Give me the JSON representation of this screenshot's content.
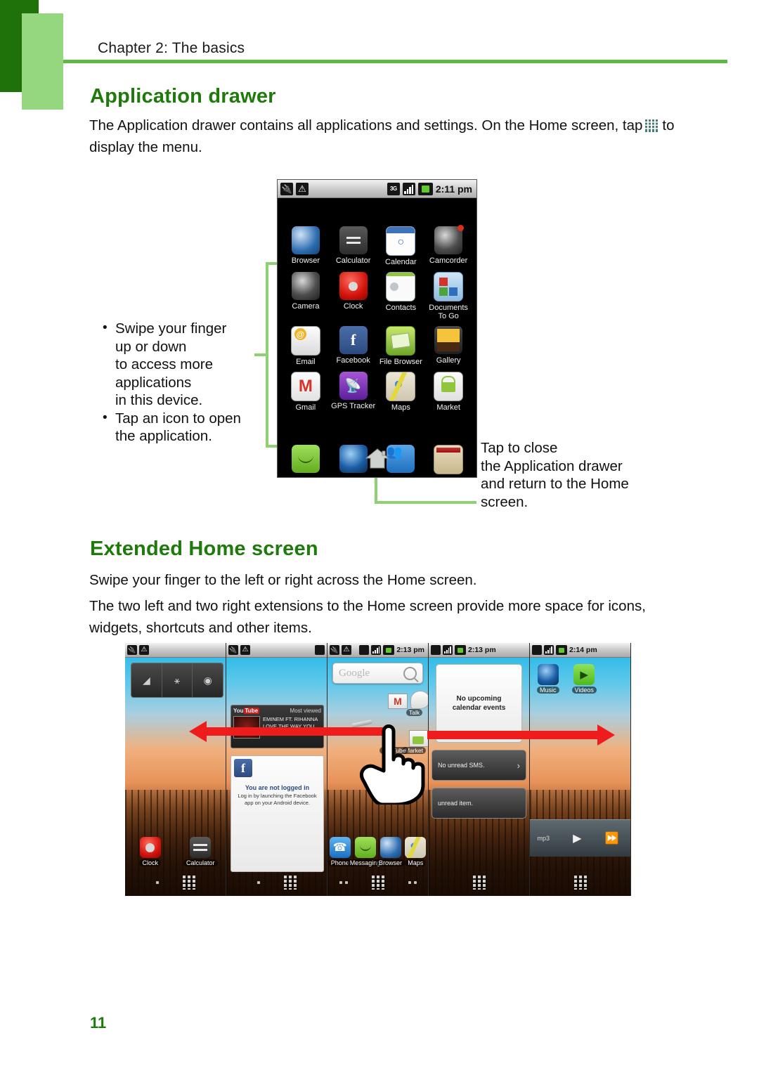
{
  "header": {
    "chapter": "Chapter 2: The basics"
  },
  "sections": {
    "app_drawer": {
      "heading": "Application drawer",
      "intro_before": "The Application drawer contains all applications and settings. On the Home screen, tap",
      "intro_after": "to display the menu.",
      "drawer_icon": "app-drawer-grid-icon"
    },
    "extended_home": {
      "heading": "Extended Home screen",
      "paragraph1": "Swipe your finger to the left or right across the Home screen.",
      "paragraph2": "The two left and two right extensions to the Home screen provide more space for icons, widgets, shortcuts and other items."
    }
  },
  "callouts": {
    "left": [
      {
        "line1": "Swipe your finger",
        "line2": "up or down",
        "line3": "to access more",
        "line4": "applications",
        "line5": "in this device."
      },
      {
        "line1": "Tap an icon to open",
        "line2": "the application."
      }
    ],
    "right": {
      "line1": "Tap to close",
      "line2": "the Application drawer",
      "line3": "and return to the Home",
      "line4": "screen."
    }
  },
  "phone_drawer": {
    "status_bar": {
      "usb_icon": "usb-icon",
      "warning_icon": "warning-triangle-icon",
      "network_label": "3G",
      "signal_icon": "signal-bars-icon",
      "battery_icon": "battery-icon",
      "time": "2:11 pm"
    },
    "apps": [
      {
        "label": "Browser",
        "icon": "browser-globe-icon"
      },
      {
        "label": "Calculator",
        "icon": "calculator-icon"
      },
      {
        "label": "Calendar",
        "icon": "calendar-icon"
      },
      {
        "label": "Camcorder",
        "icon": "camcorder-icon"
      },
      {
        "label": "Camera",
        "icon": "camera-icon"
      },
      {
        "label": "Clock",
        "icon": "clock-icon"
      },
      {
        "label": "Contacts",
        "icon": "contacts-icon"
      },
      {
        "label": "Documents To Go",
        "icon": "documents-to-go-icon"
      },
      {
        "label": "Email",
        "icon": "email-icon"
      },
      {
        "label": "Facebook",
        "icon": "facebook-icon"
      },
      {
        "label": "File Browser",
        "icon": "file-browser-icon"
      },
      {
        "label": "Gallery",
        "icon": "gallery-icon"
      },
      {
        "label": "Gmail",
        "icon": "gmail-icon"
      },
      {
        "label": "GPS Tracker",
        "icon": "gps-tracker-icon"
      },
      {
        "label": "Maps",
        "icon": "maps-icon"
      },
      {
        "label": "Market",
        "icon": "market-icon"
      }
    ],
    "home_button": "home-icon"
  },
  "home_panels": [
    {
      "name": "panel-left-2",
      "status_bar": {
        "time": ""
      },
      "toggles": [
        "wifi-icon",
        "bluetooth-icon",
        "gps-icon"
      ],
      "dock": [
        {
          "label": "Clock",
          "icon": "clock-icon"
        },
        {
          "label": "Calculator",
          "icon": "calculator-icon"
        }
      ]
    },
    {
      "name": "panel-left-1",
      "status_bar": {
        "time": ""
      },
      "youtube_widget": {
        "logo": "YouTube",
        "title": "Most viewed",
        "item_line1": "EMINEM FT. RIHANNA",
        "item_line2": "LOVE THE WAY YOU LIE"
      },
      "facebook_widget": {
        "title": "You are not logged in",
        "body": "Log in by launching the Facebook app on your Android device."
      }
    },
    {
      "name": "panel-center-home",
      "status_bar": {
        "time": "2:13 pm"
      },
      "search": {
        "placeholder": "Google",
        "icon": "search-magnifier-icon"
      },
      "shortcuts": [
        {
          "label": "Talk",
          "icon": "talk-icon"
        },
        {
          "label": "Market",
          "icon": "market-icon"
        },
        {
          "label": "YouTube",
          "icon": "youtube-icon"
        }
      ],
      "dock": [
        {
          "label": "Phone",
          "icon": "phone-icon"
        },
        {
          "label": "Messaging",
          "icon": "messaging-icon"
        },
        {
          "label": "Browser",
          "icon": "browser-globe-icon"
        },
        {
          "label": "Maps",
          "icon": "maps-icon"
        }
      ]
    },
    {
      "name": "panel-right-1",
      "status_bar": {
        "time": "2:13 pm"
      },
      "calendar_widget": {
        "line1": "No upcoming",
        "line2": "calendar events"
      },
      "sms_widget": {
        "text": "No unread SMS.",
        "chevron": "chevron-right-icon"
      },
      "news_widget": {
        "text": "unread item."
      }
    },
    {
      "name": "panel-right-2",
      "status_bar": {
        "time": "2:14 pm"
      },
      "icons": [
        {
          "label": "Music",
          "icon": "music-icon"
        },
        {
          "label": "Videos",
          "icon": "videos-icon"
        }
      ],
      "player": {
        "track": "mp3",
        "play": "play-icon",
        "next": "next-track-icon"
      }
    }
  ],
  "gesture": {
    "hand": "hand-pointer-icon",
    "arrow_left": "red-arrow-left",
    "arrow_right": "red-arrow-right"
  },
  "footer": {
    "page_number": "11"
  },
  "colors": {
    "heading_green": "#1e7a0a",
    "rule_green": "#5cba43",
    "bar_dark_green": "#1e7209",
    "bar_light_green": "#94d77e",
    "leader_green": "#8ed173",
    "arrow_red": "#ee1c1c"
  }
}
